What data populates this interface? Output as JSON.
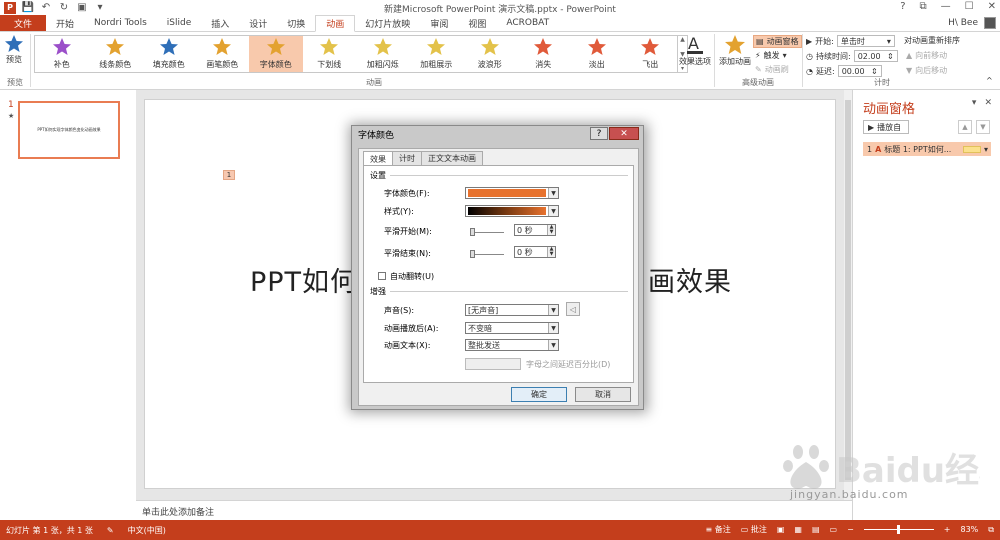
{
  "window": {
    "title": "新建Microsoft PowerPoint 演示文稿.pptx - PowerPoint",
    "logo": "P",
    "controls": [
      "?",
      "⧉",
      "—",
      "☐",
      "✕"
    ]
  },
  "tabs": [
    "文件",
    "开始",
    "Nordri Tools",
    "iSlide",
    "插入",
    "设计",
    "切换",
    "动画",
    "幻灯片放映",
    "审阅",
    "视图",
    "ACROBAT"
  ],
  "user": {
    "name": "H\\ Bee"
  },
  "ribbon": {
    "preview_label": "预览",
    "preview_group": "预览",
    "animation_group": "动画",
    "effects": [
      {
        "label": "补色",
        "color": "#9b4fc9"
      },
      {
        "label": "线条颜色",
        "color": "#e3a230"
      },
      {
        "label": "填充颜色",
        "color": "#2f6fb8"
      },
      {
        "label": "画笔颜色",
        "color": "#e3a230"
      },
      {
        "label": "字体颜色",
        "color": "#e3a230"
      },
      {
        "label": "下划线",
        "color": "#e3c24a"
      },
      {
        "label": "加粗闪烁",
        "color": "#e3c24a"
      },
      {
        "label": "加粗展示",
        "color": "#e3c24a"
      },
      {
        "label": "波浪形",
        "color": "#e3c24a"
      },
      {
        "label": "消失",
        "color": "#e05a3a"
      },
      {
        "label": "淡出",
        "color": "#e05a3a"
      },
      {
        "label": "飞出",
        "color": "#e05a3a"
      }
    ],
    "effect_options": "效果选项",
    "add_animation": "添加动画",
    "anim_pane_btn": "动画窗格",
    "trigger": "触发",
    "anim_painter": "动画刷",
    "advanced_group": "高级动画",
    "start_label": "开始:",
    "start_value": "单击时",
    "duration_label": "持续时间:",
    "duration_value": "02.00",
    "delay_label": "延迟:",
    "delay_value": "00.00",
    "reorder_label": "对动画重新排序",
    "move_earlier": "向前移动",
    "move_later": "向后移动",
    "timing_group": "计时"
  },
  "slides_panel": {
    "number": "1",
    "star": "★",
    "thumb_text": "PPT如何实现字体颜色变化动画效果"
  },
  "slide": {
    "tag": "1",
    "title_left": "PPT如何",
    "title_right": "画效果"
  },
  "notes_placeholder": "单击此处添加备注",
  "anim_pane": {
    "title": "动画窗格",
    "play": "播放自",
    "item_index": "1",
    "item_text": "标题 1: PPT如何..."
  },
  "status": {
    "slide_info": "幻灯片 第 1 张，共 1 张",
    "language": "中文(中国)",
    "notes_btn": "备注",
    "comments_btn": "批注",
    "zoom": "83%"
  },
  "dialog": {
    "title": "字体颜色",
    "help": "?",
    "close": "✕",
    "tabs": [
      "效果",
      "计时",
      "正文文本动画"
    ],
    "settings_section": "设置",
    "font_color_label": "字体颜色(F):",
    "style_label": "样式(Y):",
    "smooth_start_label": "平滑开始(M):",
    "smooth_start_value": "0 秒",
    "smooth_end_label": "平滑结束(N):",
    "smooth_end_value": "0 秒",
    "auto_reverse_label": "自动翻转(U)",
    "enhance_section": "增强",
    "sound_label": "声音(S):",
    "sound_value": "[无声音]",
    "after_anim_label": "动画播放后(A):",
    "after_anim_value": "不变暗",
    "anim_text_label": "动画文本(X):",
    "anim_text_value": "整批发送",
    "letter_delay_label": "字母之间延迟百分比(D)",
    "ok": "确定",
    "cancel": "取消",
    "font_color_hex": "#e7722e"
  },
  "watermark": {
    "brand": "Baidu经验",
    "url": "jingyan.baidu.com"
  }
}
